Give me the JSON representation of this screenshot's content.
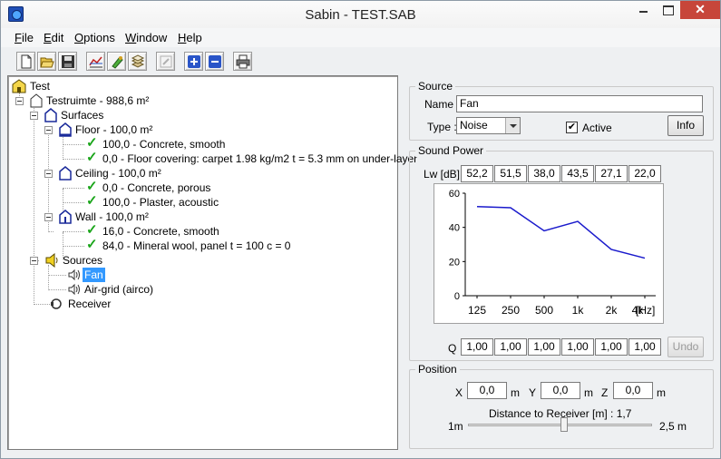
{
  "window": {
    "title": "Sabin - TEST.SAB",
    "close_glyph": "✕"
  },
  "menu": [
    {
      "label": "File",
      "key": "F",
      "rest": "ile"
    },
    {
      "label": "Edit",
      "key": "E",
      "rest": "dit"
    },
    {
      "label": "Options",
      "key": "O",
      "rest": "ptions"
    },
    {
      "label": "Window",
      "key": "W",
      "rest": "indow"
    },
    {
      "label": "Help",
      "key": "H",
      "rest": "elp"
    }
  ],
  "toolbar": [
    {
      "name": "new-file",
      "icon": "new-file-icon"
    },
    {
      "name": "open-file",
      "icon": "open-folder-icon"
    },
    {
      "name": "save",
      "icon": "floppy-icon"
    },
    {
      "name": "graph",
      "icon": "graph-icon"
    },
    {
      "name": "materials",
      "icon": "brush-icon"
    },
    {
      "name": "layers",
      "icon": "layers-icon"
    },
    {
      "name": "edit",
      "icon": "edit-icon"
    },
    {
      "name": "add",
      "icon": "plus-icon"
    },
    {
      "name": "remove",
      "icon": "minus-icon"
    },
    {
      "name": "print",
      "icon": "printer-icon"
    }
  ],
  "tree": {
    "root": "Test",
    "room": "Testruimte - 988,6 m²",
    "surfaces": "Surfaces",
    "floor": "Floor - 100,0 m²",
    "floor_mat1": "100,0 - Concrete, smooth",
    "floor_mat2": "0,0 - Floor covering: carpet 1.98 kg/m2  t = 5.3 mm on under-layer",
    "ceiling": "Ceiling - 100,0 m²",
    "ceiling_mat1": "0,0 - Concrete, porous",
    "ceiling_mat2": "100,0 - Plaster, acoustic",
    "wall": "Wall - 100,0 m²",
    "wall_mat1": "16,0 - Concrete, smooth",
    "wall_mat2": "84,0 - Mineral wool, panel  t = 100  c = 0",
    "sources": "Sources",
    "source1": "Fan",
    "source2": "Air-grid (airco)",
    "receiver": "Receiver",
    "check": "✓"
  },
  "source": {
    "group": "Source",
    "name_label": "Name :",
    "name_value": "Fan",
    "type_label": "Type :",
    "type_value": "Noise",
    "active_label": "Active",
    "active_checked": true,
    "active_mark": "✔",
    "info_button": "Info"
  },
  "sound_power": {
    "group": "Sound Power",
    "lw_label": "Lw [dB]",
    "lw": [
      "52,2",
      "51,5",
      "38,0",
      "43,5",
      "27,1",
      "22,0"
    ],
    "q_label": "Q",
    "q": [
      "1,00",
      "1,00",
      "1,00",
      "1,00",
      "1,00",
      "1,00"
    ],
    "undo_button": "Undo"
  },
  "chart_data": {
    "type": "line",
    "categories": [
      "125",
      "250",
      "500",
      "1k",
      "2k",
      "4k"
    ],
    "values": [
      52.2,
      51.5,
      38.0,
      43.5,
      27.1,
      22.0
    ],
    "unit_label": "[Hz]",
    "yticks": [
      "0",
      "20",
      "40",
      "60"
    ],
    "ylim": [
      0,
      60
    ],
    "line_color": "#1a1acc",
    "grid": false
  },
  "position": {
    "group": "Position",
    "x_label": "X",
    "x_value": "0,0",
    "x_unit": "m",
    "y_label": "Y",
    "y_value": "0,0",
    "y_unit": "m",
    "z_label": "Z",
    "z_value": "0,0",
    "z_unit": "m",
    "distance_label": "Distance to Receiver [m] :  1,7",
    "slider_min": "1m",
    "slider_max": "2,5 m",
    "slider_level": 0.52
  }
}
